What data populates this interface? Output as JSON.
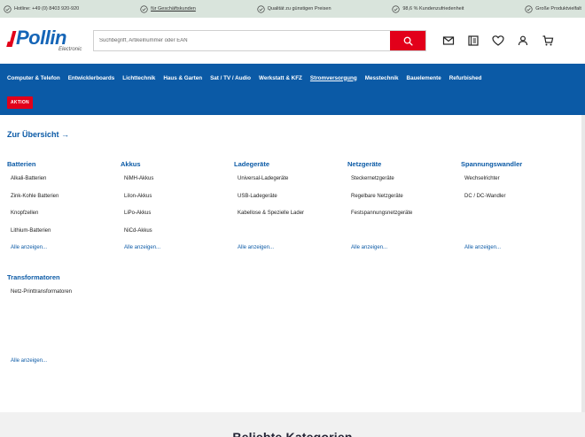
{
  "topbar": {
    "items": [
      {
        "label": "Hotline: +49 (0) 8403 920-920"
      },
      {
        "label": "für Geschäftskunden"
      },
      {
        "label": "Qualität zu günstigen Preisen"
      },
      {
        "label": "98,6 % Kundenzufriedenheit"
      },
      {
        "label": "Große Produktvielfalt"
      }
    ]
  },
  "logo": {
    "name": "Pollin",
    "sub": "Electronic"
  },
  "search": {
    "placeholder": "Suchbegriff, Artikelnummer oder EAN"
  },
  "nav": {
    "items": [
      {
        "label": "Computer & Telefon"
      },
      {
        "label": "Entwicklerboards"
      },
      {
        "label": "Lichttechnik"
      },
      {
        "label": "Haus & Garten"
      },
      {
        "label": "Sat / TV / Audio"
      },
      {
        "label": "Werkstatt & KFZ"
      },
      {
        "label": "Stromversorgung"
      },
      {
        "label": "Messtechnik"
      },
      {
        "label": "Bauelemente"
      },
      {
        "label": "Refurbished"
      }
    ],
    "aktion": "AKTION"
  },
  "mega": {
    "overview": "Zur Übersicht →",
    "show_all": "Alle anzeigen...",
    "columns": [
      {
        "title": "Batterien",
        "items": [
          "Alkali-Batterien",
          "Zink-Kohle Batterien",
          "Knopfzellen",
          "Lithium-Batterien"
        ]
      },
      {
        "title": "Akkus",
        "items": [
          "NiMH-Akkus",
          "LiIon-Akkus",
          "LiPo-Akkus",
          "NiCd-Akkus"
        ]
      },
      {
        "title": "Ladegeräte",
        "items": [
          "Universal-Ladegeräte",
          "USB-Ladegeräte",
          "Kabellose & Spezielle Lader"
        ]
      },
      {
        "title": "Netzgeräte",
        "items": [
          "Steckernetzgeräte",
          "Regelbare Netzgeräte",
          "Festspannungsnetzgeräte"
        ]
      },
      {
        "title": "Spannungswandler",
        "items": [
          "Wechselrichter",
          "DC / DC-Wandler"
        ]
      }
    ],
    "row2": {
      "title": "Transformatoren",
      "items": [
        "Netz-Printtransformatoren"
      ]
    }
  },
  "backdrop": {
    "heading": "Beliebte Kategorien"
  },
  "colors": {
    "brand_blue": "#0b5aa6",
    "brand_red": "#e2001a",
    "topbar_bg": "#d9e4dc"
  }
}
